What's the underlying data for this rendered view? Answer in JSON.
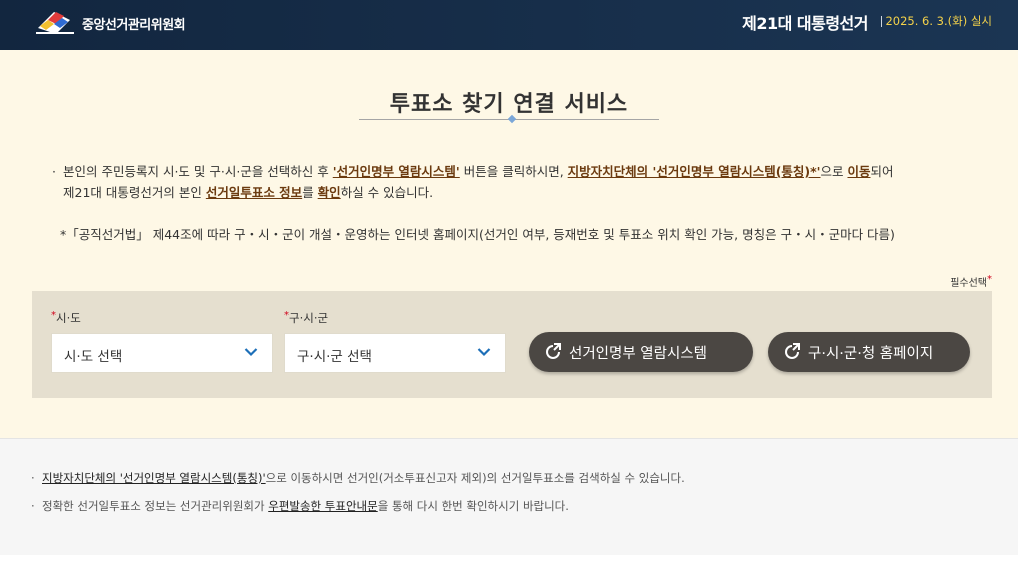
{
  "header": {
    "org_name": "중앙선거관리위원회",
    "election_title": "제21대 대통령선거",
    "election_date": "2025. 6. 3.(화) 실시"
  },
  "main": {
    "title": "투표소 찾기 연결 서비스",
    "desc1_a": "본인의 주민등록지 시·도 및 구·시·군을 선택하신 후 ",
    "desc1_b": "'선거인명부 열람시스템'",
    "desc1_c": " 버튼을 클릭하시면, ",
    "desc1_d": "지방자치단체의 '선거인명부 열람시스템(통칭)*'",
    "desc1_e": "으로 ",
    "desc1_f": "이동",
    "desc1_g": "되어",
    "desc2_a": "제21대 대통령선거의 본인 ",
    "desc2_b": "선거일투표소 정보",
    "desc2_c": "를 ",
    "desc2_d": "확인",
    "desc2_e": "하실 수 있습니다.",
    "note": "*「공직선거법」 제44조에 따라 구・시・군이 개설・운영하는 인터넷 홈페이지(선거인 여부, 등재번호 및 투표소 위치 확인 가능, 명칭은 구・시・군마다 다름)",
    "required_label": "필수선택"
  },
  "form": {
    "sido_label": "시·도",
    "sido_value": "시·도 선택",
    "gusigun_label": "구·시·군",
    "gusigun_value": "구·시·군 선택",
    "btn_registry": "선거인명부 열람시스템",
    "btn_homepage": "구·시·군·청 홈페이지"
  },
  "footer": {
    "note1_a": "지방자치단체의 '선거인명부 열람시스템(통칭)'",
    "note1_b": "으로 이동하시면 선거인(거소투표신고자 제외)의 선거일투표소를 검색하실 수 있습니다.",
    "note2_a": "정확한 선거일투표소 정보는 선거관리위원회가 ",
    "note2_b": "우편발송한 투표안내문",
    "note2_c": "을 통해 다시 한번 확인하시기 바랍니다."
  },
  "colors": {
    "header_bg": "#12263f",
    "main_bg": "#fef8e6",
    "panel_bg": "#e5dfcf",
    "button_bg": "#4b4743",
    "date_color": "#f4d24a",
    "highlight": "#6b3a0f",
    "required_star": "#d0021b",
    "chevron": "#1d6fb8"
  },
  "icons": {
    "logo": "nec-logo",
    "select_chevron": "chevron-down-icon",
    "button_icon": "external-refresh-icon"
  }
}
